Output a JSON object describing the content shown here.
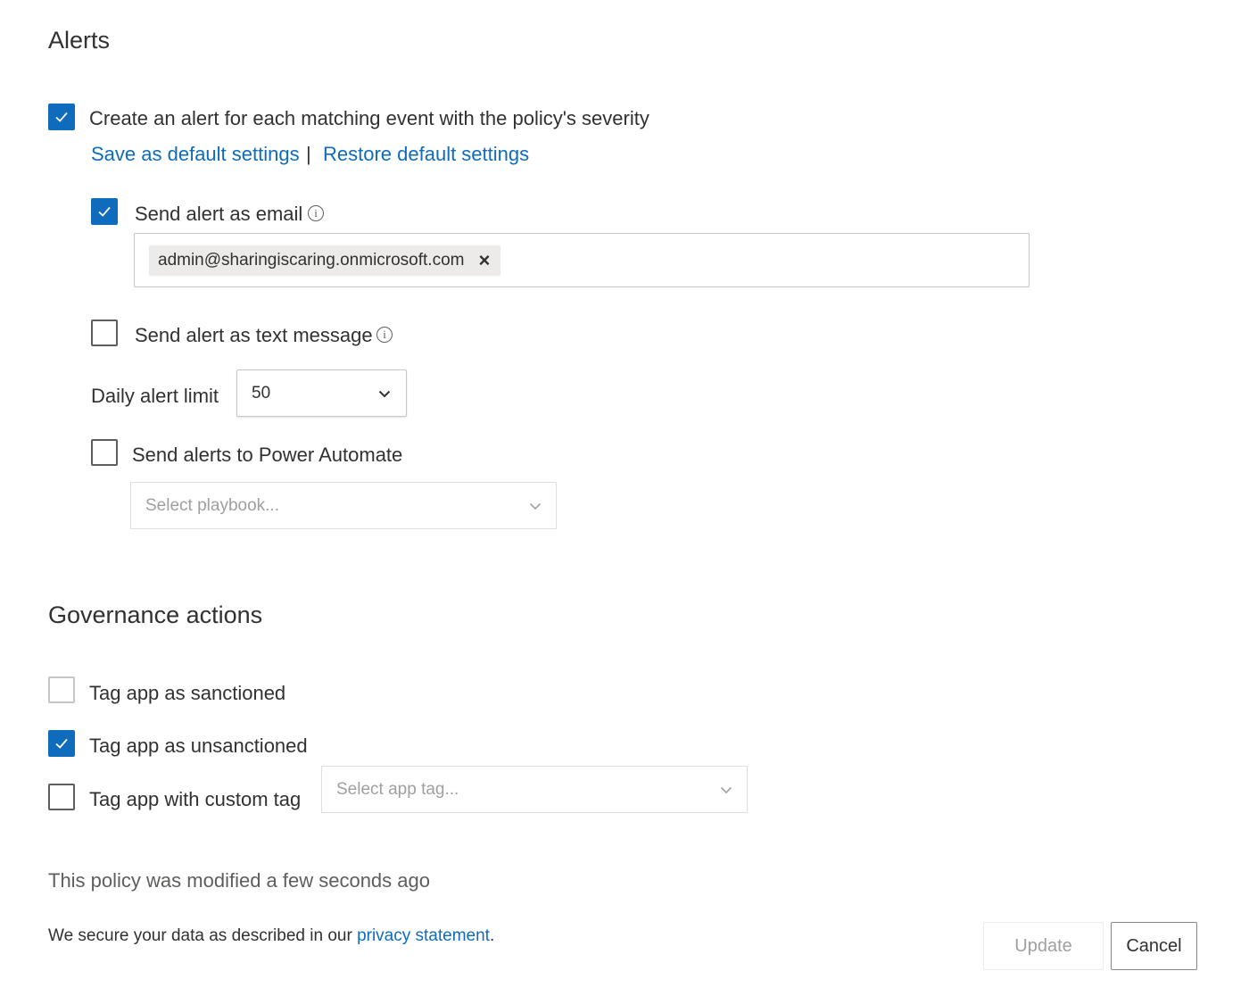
{
  "alerts": {
    "title": "Alerts",
    "create_alert": {
      "label": "Create an alert for each matching event with the policy's severity",
      "checked": true
    },
    "save_default": "Save as default settings",
    "separator": "|",
    "restore_default": "Restore default settings",
    "email": {
      "label": "Send alert as email",
      "checked": true,
      "info_icon": "info-icon",
      "recipients": [
        "admin@sharingiscaring.onmicrosoft.com"
      ],
      "remove_symbol": "×"
    },
    "sms": {
      "label": "Send alert as text message",
      "checked": false,
      "info_icon": "info-icon"
    },
    "daily_limit": {
      "label": "Daily alert limit",
      "value": "50"
    },
    "power_automate": {
      "label": "Send alerts to Power Automate",
      "checked": false,
      "placeholder": "Select playbook..."
    }
  },
  "governance": {
    "title": "Governance actions",
    "sanctioned": {
      "label": "Tag app as sanctioned",
      "checked": false
    },
    "unsanctioned": {
      "label": "Tag app as unsanctioned",
      "checked": true
    },
    "custom_tag": {
      "label": "Tag app with custom tag",
      "checked": false,
      "placeholder": "Select app tag..."
    }
  },
  "footer": {
    "modified": "This policy was modified a few seconds ago",
    "secure_prefix": "We secure your data as described in our ",
    "privacy_link": "privacy statement",
    "secure_suffix": ".",
    "update_label": "Update",
    "cancel_label": "Cancel"
  },
  "colors": {
    "accent": "#0f6cbd",
    "text": "#323130",
    "muted": "#605e5c",
    "disabled": "#a19f9d"
  }
}
